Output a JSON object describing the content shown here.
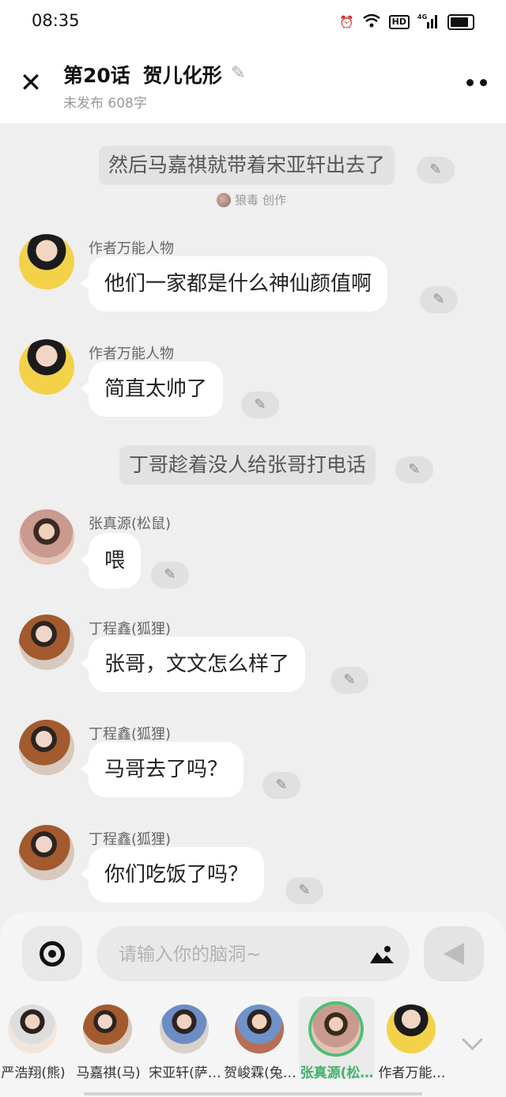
{
  "status_bar": {
    "time": "08:35",
    "hd": "HD",
    "network": "4G"
  },
  "header": {
    "chapter": "第20话",
    "chapter_title": "贺儿化形",
    "subtitle": "未发布 608字"
  },
  "narrations": [
    {
      "text": "然后马嘉祺就带着宋亚轩出去了"
    },
    {
      "text": "丁哥趁着没人给张哥打电话"
    }
  ],
  "creator": {
    "name": "狼毒",
    "suffix": "创作"
  },
  "messages": [
    {
      "name": "作者万能人物",
      "text": "他们一家都是什么神仙颜值啊"
    },
    {
      "name": "作者万能人物",
      "text": "简直太帅了"
    },
    {
      "name": "张真源(松鼠)",
      "text": "喂"
    },
    {
      "name": "丁程鑫(狐狸)",
      "text": "张哥，文文怎么样了"
    },
    {
      "name": "丁程鑫(狐狸)",
      "text": "马哥去了吗？"
    },
    {
      "name": "丁程鑫(狐狸)",
      "text": "你们吃饭了吗？"
    }
  ],
  "input": {
    "placeholder": "请输入你的脑洞~"
  },
  "characters": [
    {
      "name": "严浩翔(熊)",
      "selected": false
    },
    {
      "name": "马嘉祺(马)",
      "selected": false
    },
    {
      "name": "宋亚轩(萨…",
      "selected": false
    },
    {
      "name": "贺峻霖(兔…",
      "selected": false
    },
    {
      "name": "张真源(松…",
      "selected": true
    },
    {
      "name": "作者万能…",
      "selected": false
    }
  ],
  "colors": {
    "accent": "#43b36b",
    "background": "#efefef",
    "bubble": "#ffffff"
  }
}
